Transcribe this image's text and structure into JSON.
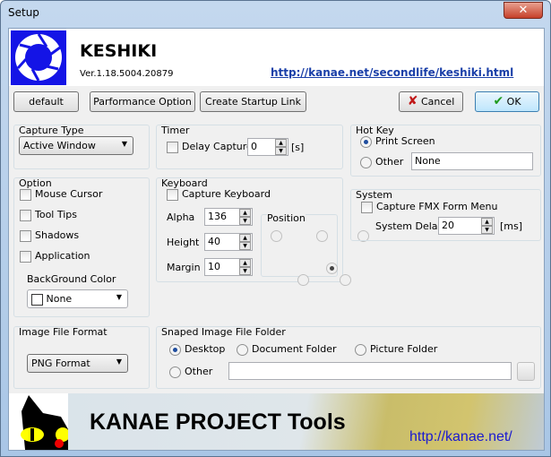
{
  "window": {
    "title": "Setup"
  },
  "header": {
    "app_name": "KESHIKI",
    "version": "Ver.1.18.5004.20879",
    "link": "http://kanae.net/secondlife/keshiki.html",
    "logo_color": "#1414e6"
  },
  "toolbar": {
    "default": "default",
    "performance": "Parformance Option",
    "startup": "Create Startup Link",
    "cancel": "Cancel",
    "ok": "OK"
  },
  "capture_type": {
    "label": "Capture Type",
    "value": "Active Window"
  },
  "timer": {
    "label": "Timer",
    "delay_label": "Delay Capture",
    "delay_checked": false,
    "delay_value": "0",
    "unit": "[s]"
  },
  "hotkey": {
    "label": "Hot Key",
    "print_screen": "Print Screen",
    "other": "Other",
    "other_value": "None",
    "selected": "Print Screen"
  },
  "option": {
    "label": "Option",
    "items": [
      {
        "label": "Mouse Cursor",
        "checked": false
      },
      {
        "label": "Tool Tips",
        "checked": false
      },
      {
        "label": "Shadows",
        "checked": false
      },
      {
        "label": "Application",
        "checked": false
      }
    ],
    "bg_label": "BackGround Color",
    "bg_value": "None"
  },
  "keyboard": {
    "label": "Keyboard",
    "capture_label": "Capture Keyboard",
    "capture_checked": false,
    "alpha_label": "Alpha",
    "alpha": "136",
    "height_label": "Height",
    "height": "40",
    "margin_label": "Margin",
    "margin": "10",
    "position_label": "Position",
    "position_selected": "bottom-left"
  },
  "system": {
    "label": "System",
    "fmx_label": "Capture FMX Form Menu",
    "fmx_checked": false,
    "delay_label": "System Delay",
    "delay": "20",
    "unit": "[ms]"
  },
  "image_format": {
    "label": "Image File Format",
    "value": "PNG Format"
  },
  "folder": {
    "label": "Snaped Image File Folder",
    "options": [
      "Desktop",
      "Document Folder",
      "Picture Folder",
      "Other"
    ],
    "selected": "Desktop",
    "path": ""
  },
  "banner": {
    "title": "KANAE PROJECT Tools",
    "link": "http://kanae.net/"
  }
}
